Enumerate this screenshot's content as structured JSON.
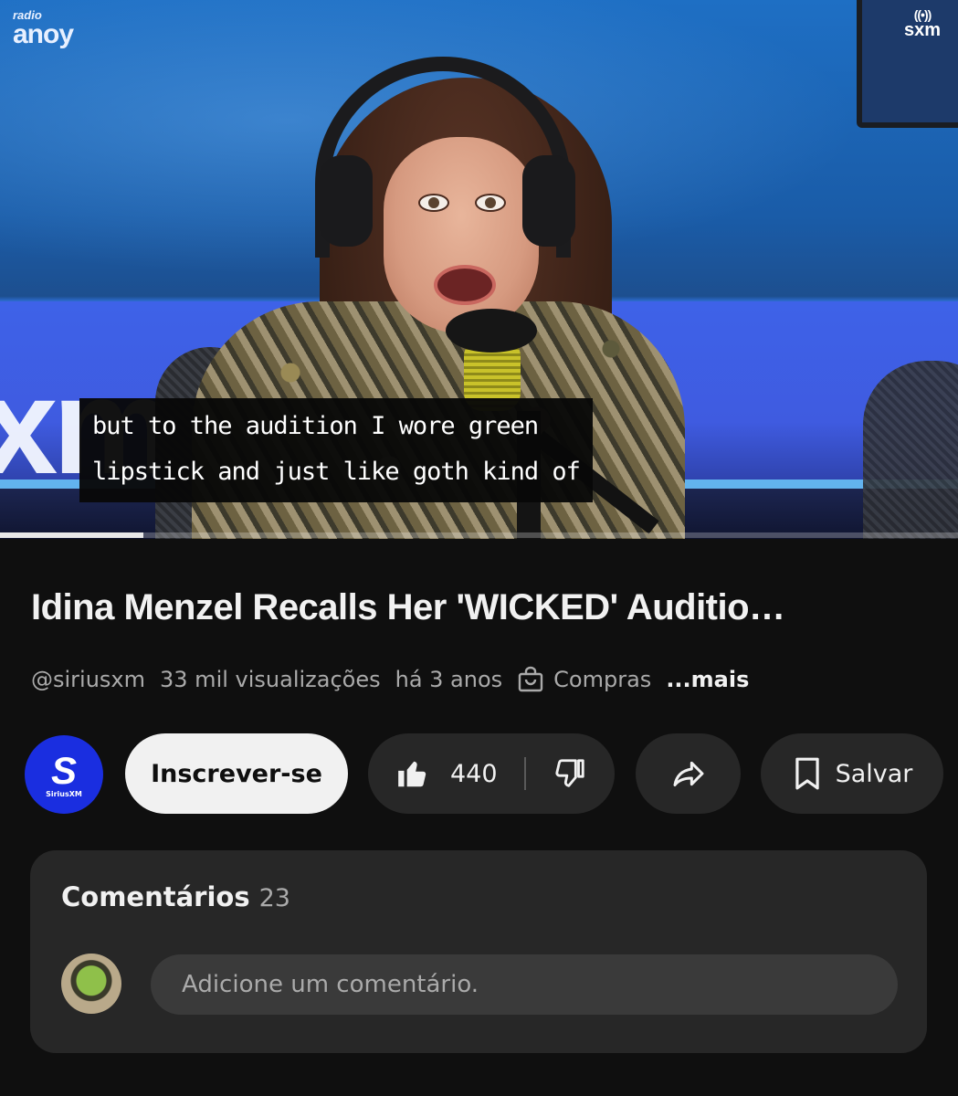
{
  "video": {
    "station_logo_top": "radio",
    "station_logo_main": "anoy",
    "corner_logo": "sxm",
    "background_logo": "xm",
    "subtitles": [
      "but to the audition I wore green",
      "lipstick and just like goth kind of"
    ],
    "progress": 0.15
  },
  "info": {
    "title": "Idina Menzel Recalls Her 'WICKED' Auditio…",
    "channel_handle": "@siriusxm",
    "views": "33 mil visualizações",
    "age": "há 3 anos",
    "shopping_label": "Compras",
    "more_label": "...mais"
  },
  "actions": {
    "channel_avatar_letter": "S",
    "channel_avatar_text": "SiriusXM",
    "subscribe_label": "Inscrever-se",
    "like_count": "440",
    "save_label": "Salvar"
  },
  "comments": {
    "title": "Comentários",
    "count": "23",
    "placeholder": "Adicione um comentário."
  },
  "icons": {
    "like": "thumbs-up-filled-icon",
    "dislike": "thumbs-down-icon",
    "share": "share-arrow-icon",
    "save": "bookmark-icon",
    "shopping": "shopping-bag-icon"
  }
}
